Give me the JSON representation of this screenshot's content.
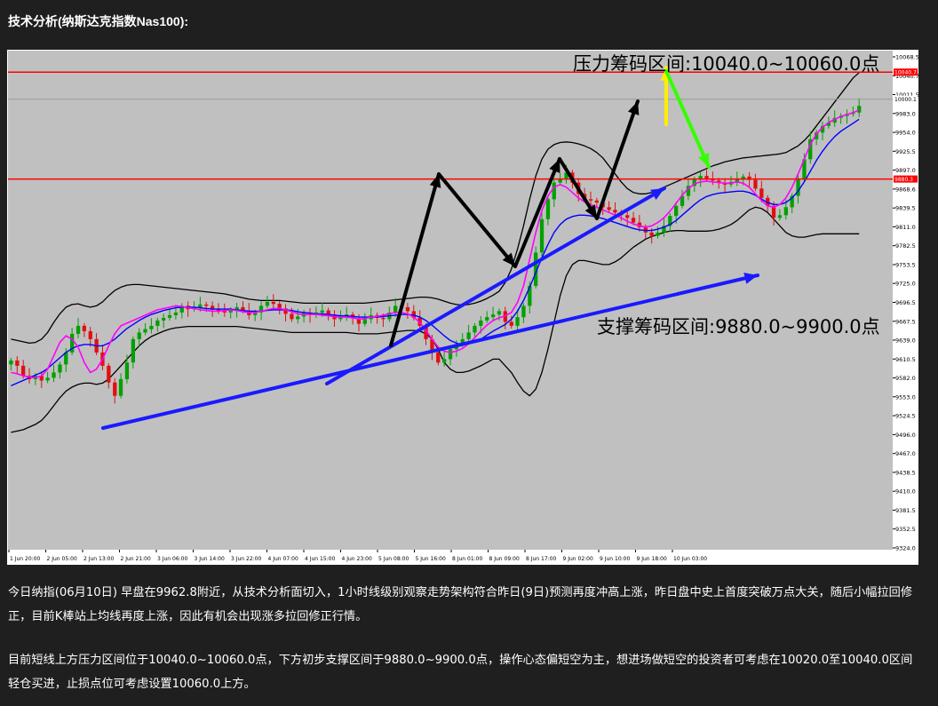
{
  "article": {
    "heading": "技术分析(纳斯达克指数Nas100):",
    "paragraphs": [
      "今日纳指(06月10日) 早盘在9962.8附近，从技术分析面切入，1小时线级别观察走势架构符合昨日(9日)预测再度冲高上涨，昨日盘中史上首度突破万点大关，随后小幅拉回修正，目前K棒站上均线再度上涨，因此有机会出现涨多拉回修正行情。",
      "目前短线上方压力区间位于10040.0~10060.0点，下方初步支撑区间于9880.0~9900.0点，操作心态偏短空为主，想进场做短空的投资者可考虑在10020.0至10040.0区间轻仓买进，止损点位可考虑设置10060.0上方。"
    ]
  },
  "colors": {
    "plot_bg": "#c0c0c0",
    "bull": "#00a000",
    "bear": "#e01010",
    "level_line": "#ff0000",
    "ma_fast": "#ff00ff",
    "ma_slow": "#0000ff",
    "band": "#000000",
    "trend_arrow": "#1a1aff",
    "up_arrow": "#ffee00",
    "down_arrow": "#33ff00"
  },
  "chart_data": {
    "type": "candlestick",
    "ylim": [
      9324,
      10073
    ],
    "yticks": [
      "10068.5",
      "10040.7",
      "10011.5",
      "9983.0",
      "9954.0",
      "9925.5",
      "9897.0",
      "9868.6",
      "9839.5",
      "9811.0",
      "9782.5",
      "9753.5",
      "9725.0",
      "9696.5",
      "9667.5",
      "9639.0",
      "9610.5",
      "9582.0",
      "9553.0",
      "9524.5",
      "9496.0",
      "9467.0",
      "9438.5",
      "9410.0",
      "9381.5",
      "9352.5",
      "9324.0"
    ],
    "xticks": [
      "1 Jun 20:00",
      "2 Jun 05:00",
      "2 Jun 13:00",
      "2 Jun 21:00",
      "3 Jun 06:00",
      "3 Jun 14:00",
      "3 Jun 22:00",
      "4 Jun 07:00",
      "4 Jun 15:00",
      "4 Jun 23:00",
      "5 Jun 08:00",
      "5 Jun 16:00",
      "8 Jun 01:00",
      "8 Jun 09:00",
      "8 Jun 17:00",
      "9 Jun 02:00",
      "9 Jun 10:00",
      "9 Jun 18:00",
      "10 Jun 03:00"
    ],
    "level_labels": {
      "resistance": "10040.7",
      "current": "10000.1",
      "support": "9880.3"
    },
    "levels": {
      "resistance": 10040.7,
      "current": 10000.1,
      "support": 9880.3
    },
    "annotations": {
      "resistance": "压力筹码区间:10040.0~10060.0点",
      "support": "支撑筹码区间:9880.0~9900.0点"
    },
    "closes": [
      9608,
      9600,
      9585,
      9580,
      9585,
      9578,
      9582,
      9590,
      9602,
      9620,
      9648,
      9660,
      9652,
      9640,
      9620,
      9600,
      9575,
      9555,
      9580,
      9605,
      9640,
      9650,
      9655,
      9660,
      9668,
      9672,
      9676,
      9680,
      9690,
      9685,
      9688,
      9692,
      9690,
      9685,
      9682,
      9680,
      9684,
      9688,
      9683,
      9676,
      9680,
      9690,
      9696,
      9693,
      9686,
      9678,
      9670,
      9674,
      9680,
      9676,
      9680,
      9683,
      9677,
      9670,
      9674,
      9677,
      9671,
      9663,
      9670,
      9676,
      9672,
      9670,
      9680,
      9690,
      9688,
      9682,
      9672,
      9660,
      9640,
      9620,
      9605,
      9610,
      9625,
      9632,
      9640,
      9650,
      9660,
      9668,
      9673,
      9677,
      9682,
      9666,
      9660,
      9673,
      9690,
      9720,
      9770,
      9820,
      9850,
      9875,
      9880,
      9890,
      9875,
      9858,
      9850,
      9848,
      9845,
      9838,
      9834,
      9830,
      9826,
      9822,
      9815,
      9808,
      9800,
      9795,
      9800,
      9810,
      9825,
      9840,
      9855,
      9870,
      9880,
      9885,
      9880,
      9878,
      9875,
      9872,
      9876,
      9880,
      9884,
      9879,
      9866,
      9852,
      9840,
      9822,
      9826,
      9838,
      9855,
      9880,
      9910,
      9940,
      9950,
      9960,
      9965,
      9972,
      9975,
      9978,
      9980,
      9990
    ],
    "ma_fast": [
      9590,
      9588,
      9585,
      9583,
      9582,
      9585,
      9595,
      9615,
      9635,
      9645,
      9640,
      9628,
      9605,
      9590,
      9595,
      9610,
      9630,
      9648,
      9660,
      9664,
      9668,
      9672,
      9676,
      9680,
      9684,
      9686,
      9688,
      9690,
      9689,
      9687,
      9686,
      9684,
      9683,
      9682,
      9682,
      9683,
      9684,
      9683,
      9681,
      9680,
      9680,
      9682,
      9684,
      9686,
      9686,
      9684,
      9681,
      9678,
      9677,
      9677,
      9677,
      9676,
      9675,
      9674,
      9673,
      9673,
      9672,
      9670,
      9671,
      9673,
      9674,
      9676,
      9678,
      9680,
      9680,
      9678,
      9673,
      9665,
      9653,
      9640,
      9628,
      9622,
      9620,
      9622,
      9626,
      9633,
      9642,
      9652,
      9661,
      9668,
      9672,
      9675,
      9680,
      9695,
      9720,
      9760,
      9800,
      9833,
      9855,
      9868,
      9872,
      9868,
      9860,
      9852,
      9846,
      9842,
      9838,
      9834,
      9830,
      9826,
      9822,
      9817,
      9813,
      9810,
      9808,
      9810,
      9815,
      9822,
      9832,
      9844,
      9856,
      9866,
      9873,
      9876,
      9877,
      9876,
      9875,
      9874,
      9874,
      9876,
      9874,
      9868,
      9858,
      9848,
      9840,
      9838,
      9842,
      9852,
      9868,
      9888,
      9910,
      9932,
      9948,
      9958,
      9965,
      9970,
      9974,
      9977,
      9980,
      9984
    ],
    "ma_slow": [
      9570,
      9574,
      9578,
      9582,
      9586,
      9590,
      9596,
      9604,
      9612,
      9620,
      9626,
      9630,
      9632,
      9632,
      9630,
      9630,
      9634,
      9640,
      9648,
      9656,
      9662,
      9668,
      9673,
      9677,
      9680,
      9683,
      9685,
      9687,
      9688,
      9688,
      9688,
      9687,
      9686,
      9685,
      9685,
      9685,
      9685,
      9684,
      9683,
      9682,
      9682,
      9682,
      9683,
      9684,
      9684,
      9684,
      9683,
      9681,
      9680,
      9679,
      9678,
      9678,
      9677,
      9676,
      9675,
      9675,
      9674,
      9673,
      9673,
      9673,
      9673,
      9674,
      9675,
      9676,
      9677,
      9677,
      9676,
      9673,
      9668,
      9661,
      9653,
      9645,
      9638,
      9634,
      9632,
      9633,
      9636,
      9640,
      9646,
      9652,
      9657,
      9662,
      9670,
      9682,
      9698,
      9718,
      9740,
      9762,
      9782,
      9800,
      9812,
      9820,
      9824,
      9826,
      9826,
      9825,
      9823,
      9821,
      9818,
      9815,
      9812,
      9809,
      9806,
      9804,
      9803,
      9803,
      9805,
      9808,
      9812,
      9818,
      9826,
      9834,
      9842,
      9849,
      9854,
      9857,
      9859,
      9860,
      9861,
      9862,
      9862,
      9860,
      9856,
      9850,
      9845,
      9842,
      9842,
      9845,
      9852,
      9862,
      9876,
      9892,
      9908,
      9922,
      9934,
      9944,
      9952,
      9958,
      9964,
      9970
    ],
    "band_upper": [
      9640,
      9638,
      9636,
      9634,
      9635,
      9640,
      9650,
      9665,
      9678,
      9688,
      9692,
      9693,
      9690,
      9688,
      9690,
      9696,
      9705,
      9713,
      9718,
      9721,
      9722,
      9722,
      9721,
      9720,
      9719,
      9718,
      9717,
      9716,
      9715,
      9714,
      9713,
      9712,
      9711,
      9710,
      9709,
      9708,
      9706,
      9704,
      9702,
      9700,
      9699,
      9698,
      9698,
      9698,
      9698,
      9697,
      9696,
      9695,
      9694,
      9694,
      9694,
      9694,
      9694,
      9694,
      9694,
      9694,
      9694,
      9694,
      9694,
      9695,
      9696,
      9697,
      9698,
      9699,
      9700,
      9701,
      9702,
      9703,
      9703,
      9702,
      9700,
      9697,
      9694,
      9692,
      9691,
      9692,
      9694,
      9697,
      9701,
      9706,
      9712,
      9725,
      9745,
      9775,
      9810,
      9850,
      9885,
      9910,
      9925,
      9932,
      9935,
      9936,
      9935,
      9933,
      9930,
      9926,
      9920,
      9912,
      9900,
      9888,
      9876,
      9866,
      9860,
      9858,
      9858,
      9860,
      9864,
      9868,
      9872,
      9876,
      9880,
      9884,
      9888,
      9892,
      9896,
      9900,
      9903,
      9906,
      9908,
      9910,
      9912,
      9913,
      9914,
      9915,
      9916,
      9917,
      9918,
      9920,
      9925,
      9930,
      9938,
      9948,
      9960,
      9972,
      9984,
      9996,
      10008,
      10020,
      10032,
      10040
    ],
    "band_lower": [
      9500,
      9502,
      9504,
      9508,
      9512,
      9518,
      9528,
      9540,
      9552,
      9562,
      9568,
      9572,
      9574,
      9574,
      9572,
      9574,
      9580,
      9590,
      9600,
      9610,
      9620,
      9630,
      9638,
      9644,
      9648,
      9652,
      9655,
      9657,
      9658,
      9659,
      9659,
      9659,
      9659,
      9659,
      9659,
      9659,
      9659,
      9659,
      9658,
      9657,
      9656,
      9655,
      9654,
      9653,
      9652,
      9651,
      9650,
      9650,
      9650,
      9650,
      9650,
      9650,
      9650,
      9650,
      9650,
      9650,
      9649,
      9648,
      9648,
      9648,
      9648,
      9649,
      9650,
      9651,
      9652,
      9653,
      9653,
      9652,
      9648,
      9640,
      9625,
      9605,
      9595,
      9590,
      9590,
      9592,
      9596,
      9600,
      9605,
      9610,
      9610,
      9600,
      9590,
      9575,
      9562,
      9555,
      9565,
      9590,
      9625,
      9665,
      9705,
      9735,
      9752,
      9758,
      9758,
      9756,
      9754,
      9752,
      9752,
      9756,
      9762,
      9770,
      9778,
      9784,
      9790,
      9794,
      9797,
      9800,
      9802,
      9803,
      9803,
      9802,
      9802,
      9802,
      9802,
      9803,
      9805,
      9808,
      9812,
      9818,
      9826,
      9834,
      9838,
      9836,
      9830,
      9820,
      9810,
      9800,
      9795,
      9793,
      9793,
      9795,
      9797,
      9798,
      9798,
      9798,
      9798,
      9798,
      9798,
      9798
    ]
  }
}
